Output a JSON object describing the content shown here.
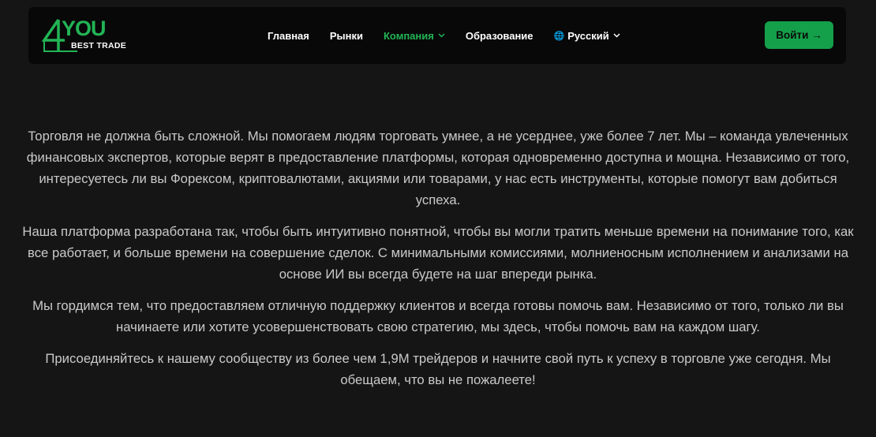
{
  "logo": {
    "brand": "YOU",
    "tagline": "BEST TRADE",
    "brand_color": "#22b455"
  },
  "nav": {
    "items": [
      {
        "label": "Главная",
        "active": false,
        "has_dropdown": false
      },
      {
        "label": "Рынки",
        "active": false,
        "has_dropdown": false
      },
      {
        "label": "Компания",
        "active": true,
        "has_dropdown": true
      },
      {
        "label": "Образование",
        "active": false,
        "has_dropdown": false
      }
    ],
    "language": {
      "label": "Русский",
      "icon": "globe-icon"
    },
    "login_label": "Войти →"
  },
  "content": {
    "paragraphs": [
      "Торговля не должна быть сложной. Мы помогаем людям торговать умнее, а не усерднее, уже более 7 лет. Мы – команда увлеченных финансовых экспертов, которые верят в предоставление платформы, которая одновременно доступна и мощна. Независимо от того, интересуетесь ли вы Форексом, криптовалютами, акциями или товарами, у нас есть инструменты, которые помогут вам добиться успеха.",
      "Наша платформа разработана так, чтобы быть интуитивно понятной, чтобы вы могли тратить меньше времени на понимание того, как все работает, и больше времени на совершение сделок. С минимальными комиссиями, молниеносным исполнением и анализами на основе ИИ вы всегда будете на шаг впереди рынка.",
      "Мы гордимся тем, что предоставляем отличную поддержку клиентов и всегда готовы помочь вам. Независимо от того, только ли вы начинаете или хотите усовершенствовать свою стратегию, мы здесь, чтобы помочь вам на каждом шагу.",
      "Присоединяйтесь к нашему сообществу из более чем 1,9M трейдеров и начните свой путь к успеху в торговле уже сегодня. Мы обещаем, что вы не пожалеете!"
    ]
  },
  "colors": {
    "page_bg": "#151515",
    "nav_bg": "#080808",
    "accent": "#22b455",
    "button_bg": "#14a04a",
    "text": "#c9c9c9"
  }
}
